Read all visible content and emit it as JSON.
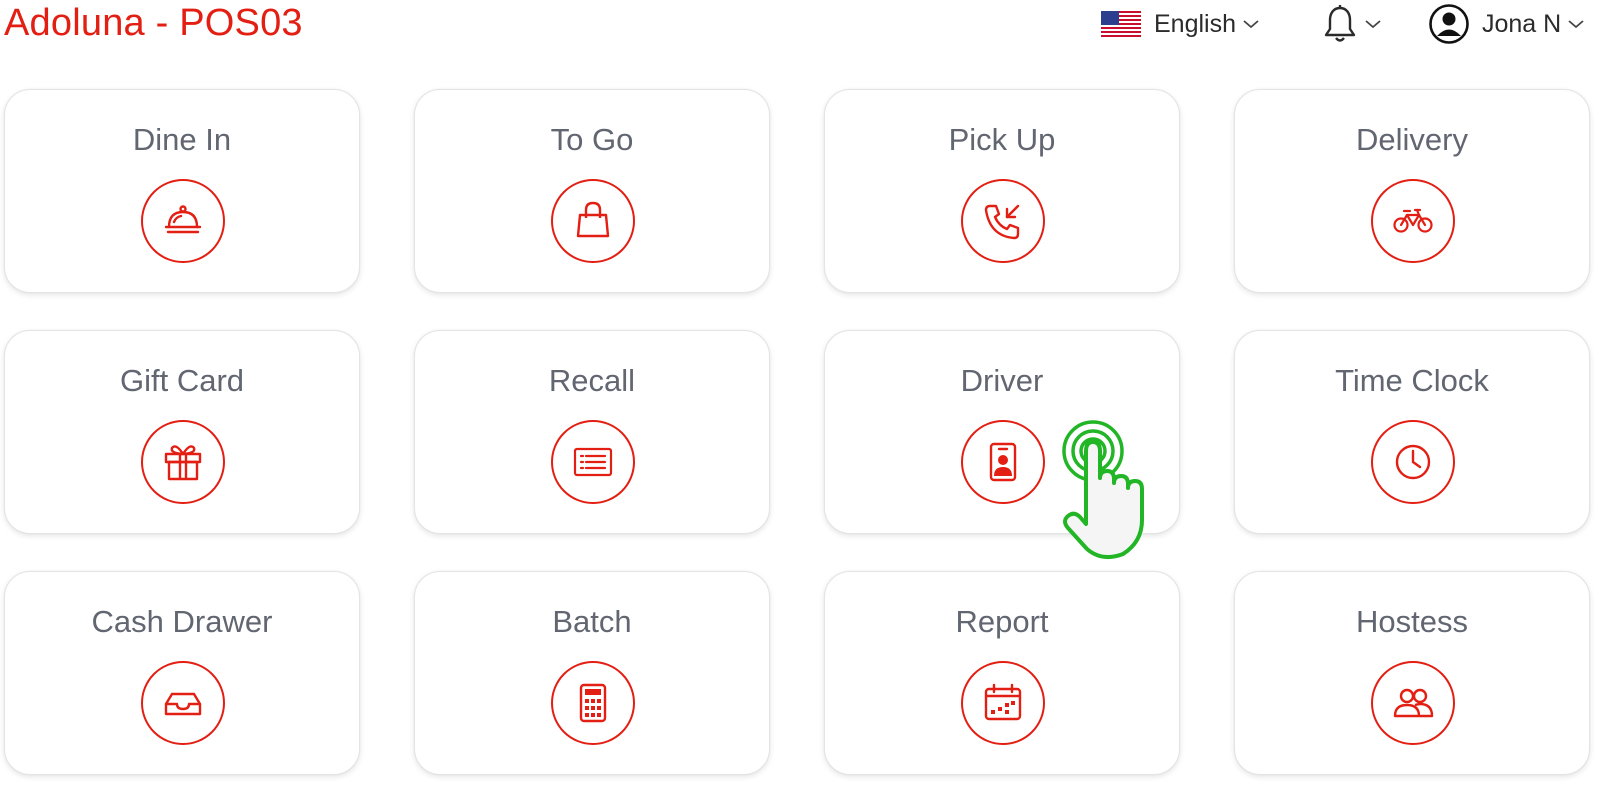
{
  "app": {
    "title": "Adoluna - POS03"
  },
  "header": {
    "language": {
      "label": "English",
      "flag_icon": "us-flag-icon"
    },
    "notifications": {
      "icon": "bell-icon"
    },
    "user": {
      "name": "Jona N",
      "icon": "user-circle-icon"
    }
  },
  "colors": {
    "accent": "#e31e12",
    "label": "#616671",
    "cursor": "#22b526"
  },
  "tiles": [
    {
      "label": "Dine In",
      "icon": "cloche-icon"
    },
    {
      "label": "To Go",
      "icon": "shopping-bag-icon"
    },
    {
      "label": "Pick Up",
      "icon": "phone-incoming-icon"
    },
    {
      "label": "Delivery",
      "icon": "bicycle-icon"
    },
    {
      "label": "Gift Card",
      "icon": "gift-icon"
    },
    {
      "label": "Recall",
      "icon": "receipt-list-icon"
    },
    {
      "label": "Driver",
      "icon": "id-badge-icon"
    },
    {
      "label": "Time Clock",
      "icon": "clock-icon"
    },
    {
      "label": "Cash Drawer",
      "icon": "tray-icon"
    },
    {
      "label": "Batch",
      "icon": "calculator-icon"
    },
    {
      "label": "Report",
      "icon": "calendar-report-icon"
    },
    {
      "label": "Hostess",
      "icon": "people-icon"
    }
  ]
}
